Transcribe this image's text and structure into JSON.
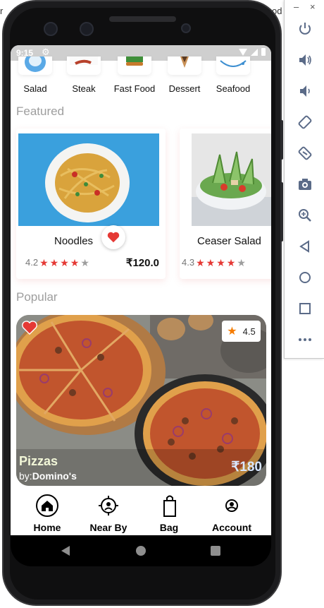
{
  "desktop": {
    "edge_left": "r",
    "edge_right": "od"
  },
  "status_bar": {
    "time": "9:15"
  },
  "categories": [
    {
      "label": "Salad"
    },
    {
      "label": "Steak"
    },
    {
      "label": "Fast Food"
    },
    {
      "label": "Dessert"
    },
    {
      "label": "Seafood"
    }
  ],
  "featured": {
    "title": "Featured",
    "items": [
      {
        "name": "Noodles",
        "rating": "4.2",
        "stars": 4,
        "price": "₹120.0",
        "favorited": true
      },
      {
        "name": "Ceaser Salad",
        "rating": "4.3",
        "stars": 4,
        "price": ""
      }
    ]
  },
  "popular": {
    "title": "Popular",
    "item": {
      "name": "Pizzas",
      "by_prefix": "by:",
      "by_name": "Domino's",
      "price": "₹180",
      "rating": "4.5",
      "favorited": true
    }
  },
  "bottom_nav": [
    {
      "label": "Home",
      "icon": "home-icon",
      "active": true
    },
    {
      "label": "Near By",
      "icon": "near-by-icon"
    },
    {
      "label": "Bag",
      "icon": "bag-icon"
    },
    {
      "label": "Account",
      "icon": "account-icon"
    }
  ],
  "emulator_toolbar": {
    "minimize": "–",
    "close": "×",
    "buttons": [
      "power-icon",
      "volume-up-icon",
      "volume-down-icon",
      "rotate-left-icon",
      "rotate-right-icon",
      "screenshot-icon",
      "zoom-icon",
      "back-icon",
      "home-icon",
      "overview-icon",
      "more-icon"
    ]
  },
  "colors": {
    "accent_red": "#e53935",
    "star_orange": "#f57c00",
    "muted_grey": "#9e9e9e"
  }
}
